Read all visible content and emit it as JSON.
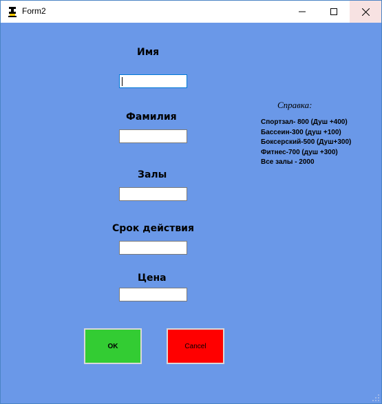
{
  "window": {
    "title": "Form2"
  },
  "titlebar": {
    "minimize_icon": "minimize-icon",
    "maximize_icon": "maximize-icon",
    "close_icon": "close-icon"
  },
  "form": {
    "name_label": "Имя",
    "name_value": "",
    "surname_label": "Фамилия",
    "surname_value": "",
    "halls_label": "Залы",
    "halls_value": "",
    "validity_label": "Срок действия",
    "validity_value": "",
    "price_label": "Цена",
    "price_value": ""
  },
  "help": {
    "title": "Справка:",
    "items": [
      "Спортзал- 800 (Душ +400)",
      "Бассеин-300 (душ +100)",
      "Боксерский-500 (Душ+300)",
      "Фитнес-700 (душ +300)",
      "Все залы - 2000"
    ]
  },
  "buttons": {
    "ok_label": "OK",
    "cancel_label": "Cancel"
  },
  "colors": {
    "form_background": "#6a98e8",
    "ok_button": "#33cc33",
    "cancel_button": "#ff0000"
  }
}
